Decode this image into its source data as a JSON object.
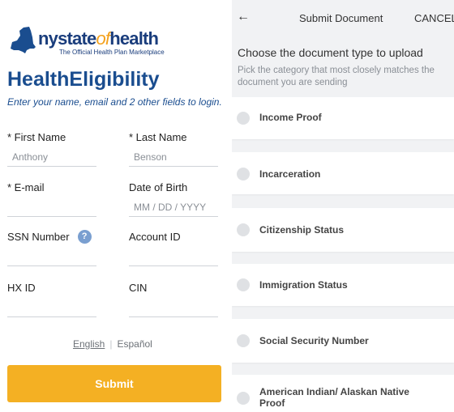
{
  "left": {
    "logo": {
      "name_pre": "nystate",
      "name_of": "of",
      "name_post": "health",
      "tagline": "The Official Health Plan Marketplace"
    },
    "title": "HealthEligibility",
    "subtitle": "Enter your name, email and 2 other fields to login.",
    "fields": {
      "first_name": {
        "label": "* First Name",
        "value": "Anthony"
      },
      "last_name": {
        "label": "* Last Name",
        "value": "Benson"
      },
      "email": {
        "label": "* E-mail",
        "value": ""
      },
      "dob": {
        "label": "Date of Birth",
        "placeholder": "MM / DD / YYYY"
      },
      "ssn": {
        "label": "SSN Number",
        "help": "?",
        "value": ""
      },
      "account_id": {
        "label": "Account ID",
        "value": ""
      },
      "hx_id": {
        "label": "HX ID",
        "value": ""
      },
      "cin": {
        "label": "CIN",
        "value": ""
      }
    },
    "languages": {
      "english": "English",
      "separator": "|",
      "spanish": "Español"
    },
    "submit_label": "Submit"
  },
  "right": {
    "header": {
      "back_icon": "arrow-left-icon",
      "back_glyph": "←",
      "title": "Submit Document",
      "cancel": "CANCEL"
    },
    "heading": "Choose the document type to upload",
    "help": "Pick the category that most closely matches the document you are sending",
    "doc_types": [
      "Income Proof",
      "Incarceration",
      "Citizenship Status",
      "Immigration Status",
      "Social Security Number",
      "American Indian/ Alaskan Native Proof"
    ]
  },
  "colors": {
    "brand_blue": "#1a4d8f",
    "brand_orange": "#f4a11c",
    "submit": "#f4b023"
  }
}
